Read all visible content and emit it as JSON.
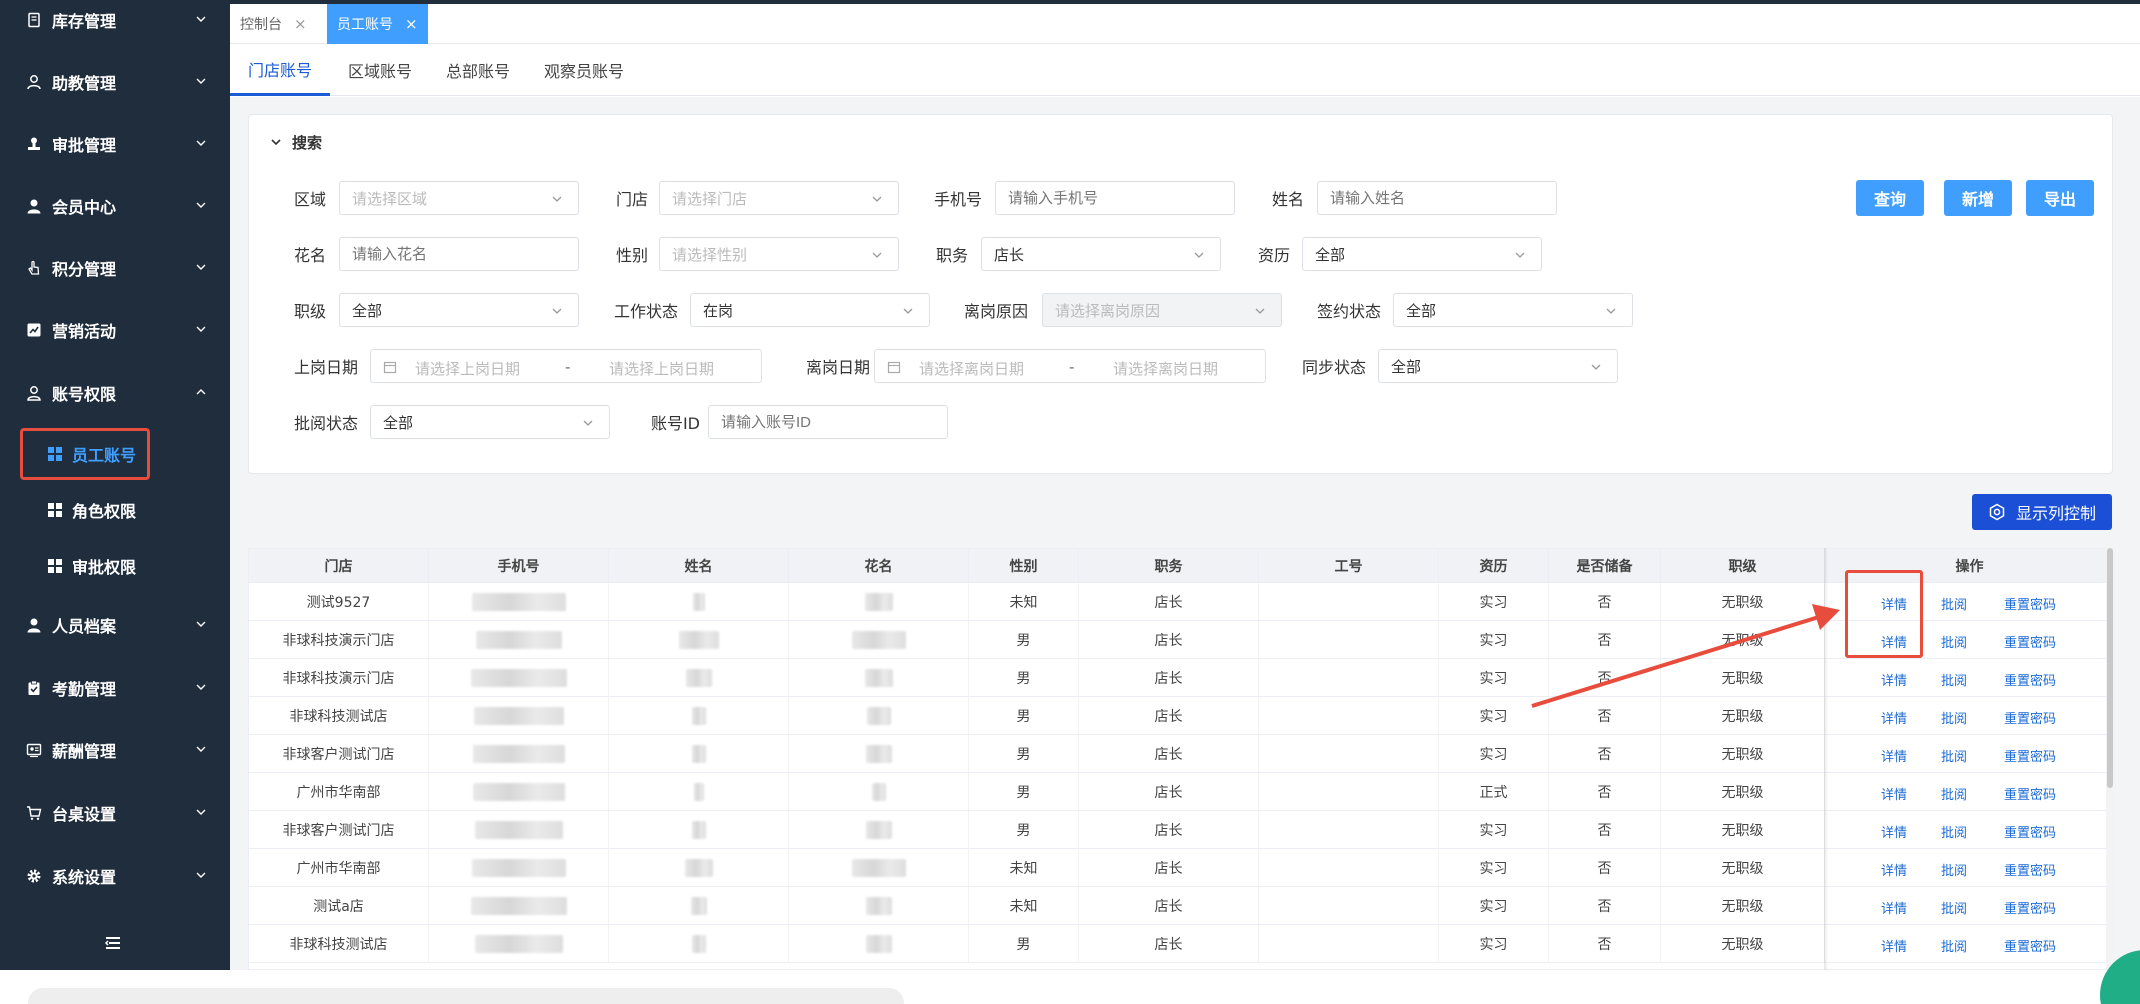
{
  "sidebar": {
    "items": [
      {
        "label": "库存管理"
      },
      {
        "label": "助教管理"
      },
      {
        "label": "审批管理"
      },
      {
        "label": "会员中心"
      },
      {
        "label": "积分管理"
      },
      {
        "label": "营销活动"
      },
      {
        "label": "账号权限"
      },
      {
        "label": "人员档案"
      },
      {
        "label": "考勤管理"
      },
      {
        "label": "薪酬管理"
      },
      {
        "label": "台桌设置"
      },
      {
        "label": "系统设置"
      }
    ],
    "sub_items": [
      {
        "label": "员工账号"
      },
      {
        "label": "角色权限"
      },
      {
        "label": "审批权限"
      }
    ]
  },
  "tabs": [
    {
      "label": "控制台"
    },
    {
      "label": "员工账号"
    }
  ],
  "subtabs": [
    {
      "label": "门店账号"
    },
    {
      "label": "区域账号"
    },
    {
      "label": "总部账号"
    },
    {
      "label": "观察员账号"
    }
  ],
  "search": {
    "title": "搜索",
    "fields": {
      "region": {
        "label": "区域",
        "placeholder": "请选择区域"
      },
      "store": {
        "label": "门店",
        "placeholder": "请选择门店"
      },
      "phone": {
        "label": "手机号",
        "placeholder": "请输入手机号"
      },
      "name": {
        "label": "姓名",
        "placeholder": "请输入姓名"
      },
      "nickname": {
        "label": "花名",
        "placeholder": "请输入花名"
      },
      "gender": {
        "label": "性别",
        "placeholder": "请选择性别"
      },
      "position": {
        "label": "职务",
        "value": "店长"
      },
      "seniority": {
        "label": "资历",
        "value": "全部"
      },
      "rank": {
        "label": "职级",
        "value": "全部"
      },
      "work_status": {
        "label": "工作状态",
        "value": "在岗"
      },
      "leave_reason": {
        "label": "离岗原因",
        "placeholder": "请选择离岗原因"
      },
      "contract_status": {
        "label": "签约状态",
        "value": "全部"
      },
      "start_date": {
        "label": "上岗日期",
        "from_placeholder": "请选择上岗日期",
        "to_placeholder": "请选择上岗日期"
      },
      "leave_date": {
        "label": "离岗日期",
        "from_placeholder": "请选择离岗日期",
        "to_placeholder": "请选择离岗日期"
      },
      "sync_status": {
        "label": "同步状态",
        "value": "全部"
      },
      "review_status": {
        "label": "批阅状态",
        "value": "全部"
      },
      "account_id": {
        "label": "账号ID",
        "placeholder": "请输入账号ID"
      }
    },
    "range_sep": "-",
    "buttons": {
      "query": "查询",
      "add": "新增",
      "export": "导出"
    }
  },
  "column_control": "显示列控制",
  "table": {
    "headers": [
      "门店",
      "手机号",
      "姓名",
      "花名",
      "性别",
      "职务",
      "工号",
      "资历",
      "是否储备",
      "职级",
      "操作"
    ],
    "actions": [
      "详情",
      "批阅",
      "重置密码"
    ],
    "rows": [
      {
        "store": "测试9527",
        "gender": "未知",
        "position": "店长",
        "seniority": "实习",
        "reserve": "否",
        "rank": "无职级"
      },
      {
        "store": "非球科技演示门店",
        "gender": "男",
        "position": "店长",
        "seniority": "实习",
        "reserve": "否",
        "rank": "无职级"
      },
      {
        "store": "非球科技演示门店",
        "gender": "男",
        "position": "店长",
        "seniority": "实习",
        "reserve": "否",
        "rank": "无职级"
      },
      {
        "store": "非球科技测试店",
        "gender": "男",
        "position": "店长",
        "seniority": "实习",
        "reserve": "否",
        "rank": "无职级"
      },
      {
        "store": "非球客户测试门店",
        "gender": "男",
        "position": "店长",
        "seniority": "实习",
        "reserve": "否",
        "rank": "无职级"
      },
      {
        "store": "广州市华南部",
        "gender": "男",
        "position": "店长",
        "seniority": "正式",
        "reserve": "否",
        "rank": "无职级"
      },
      {
        "store": "非球客户测试门店",
        "gender": "男",
        "position": "店长",
        "seniority": "实习",
        "reserve": "否",
        "rank": "无职级"
      },
      {
        "store": "广州市华南部",
        "gender": "未知",
        "position": "店长",
        "seniority": "实习",
        "reserve": "否",
        "rank": "无职级"
      },
      {
        "store": "测试a店",
        "gender": "未知",
        "position": "店长",
        "seniority": "实习",
        "reserve": "否",
        "rank": "无职级"
      },
      {
        "store": "非球科技测试店",
        "gender": "男",
        "position": "店长",
        "seniority": "实习",
        "reserve": "否",
        "rank": "无职级"
      }
    ]
  },
  "colors": {
    "primary": "#409eff",
    "dark_button": "#1a4fd6",
    "sidebar_bg": "#1f2d3d",
    "annotation": "#e74c3c"
  }
}
